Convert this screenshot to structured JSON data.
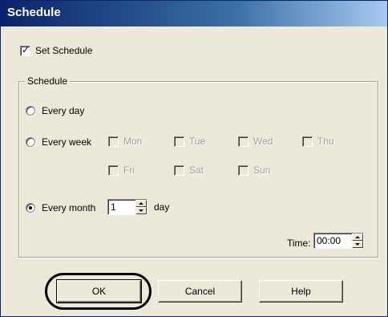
{
  "window": {
    "title": "Schedule"
  },
  "set_schedule": {
    "label": "Set Schedule",
    "checked": true
  },
  "group": {
    "title": "Schedule",
    "every_day": {
      "label": "Every day",
      "selected": false
    },
    "every_week": {
      "label": "Every week",
      "selected": false,
      "days": [
        {
          "label": "Mon",
          "checked": false
        },
        {
          "label": "Tue",
          "checked": false
        },
        {
          "label": "Wed",
          "checked": false
        },
        {
          "label": "Thu",
          "checked": false
        },
        {
          "label": "Fri",
          "checked": false
        },
        {
          "label": "Sat",
          "checked": false
        },
        {
          "label": "Sun",
          "checked": false
        }
      ]
    },
    "every_month": {
      "label": "Every month",
      "selected": true,
      "day_value": "1",
      "day_suffix": "day"
    },
    "time": {
      "label": "Time:",
      "value": "00:00"
    }
  },
  "buttons": {
    "ok": "OK",
    "cancel": "Cancel",
    "help": "Help"
  },
  "colors": {
    "title_bar": "#0a246a",
    "dialog_bg": "#ece9d8",
    "disabled_text": "#a0a0a0"
  }
}
